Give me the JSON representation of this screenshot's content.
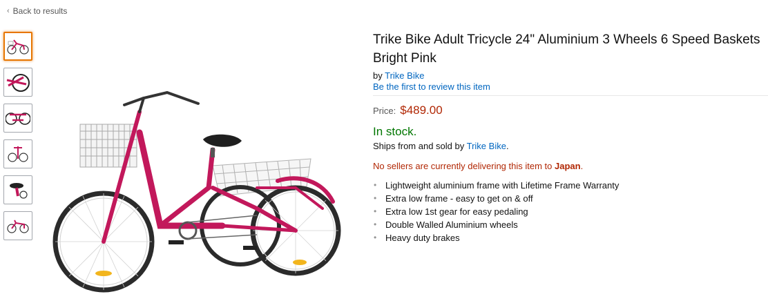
{
  "nav": {
    "back_label": "Back to results"
  },
  "thumbnails": [
    {
      "icon": "bike-front-thumbnail",
      "selected": true
    },
    {
      "icon": "bike-wheel-thumbnail",
      "selected": false
    },
    {
      "icon": "bike-rear-thumbnail",
      "selected": false
    },
    {
      "icon": "bike-frontview-thumbnail",
      "selected": false
    },
    {
      "icon": "bike-seat-thumbnail",
      "selected": false
    },
    {
      "icon": "bike-side-thumbnail",
      "selected": false
    }
  ],
  "product": {
    "title": "Trike Bike Adult Tricycle 24\" Aluminium 3 Wheels 6 Speed Baskets Bright Pink",
    "by_prefix": "by",
    "brand": "Trike Bike",
    "review_link": "Be the first to review this item",
    "price_label": "Price:",
    "price": "$489.00",
    "stock": "In stock.",
    "ships_prefix": "Ships from and sold by",
    "seller": "Trike Bike",
    "ships_suffix": ".",
    "no_delivery_text": "No sellers are currently delivering this item to",
    "no_delivery_country": "Japan",
    "no_delivery_suffix": ".",
    "features": [
      "Lightweight aluminium frame with Lifetime Frame Warranty",
      "Extra low frame - easy to get on & off",
      "Extra low 1st gear for easy pedaling",
      "Double Walled Aluminium wheels",
      "Heavy duty brakes"
    ]
  },
  "colors": {
    "frame": "#c2185b",
    "link": "#0066c0",
    "price": "#b12704",
    "stock": "#007600",
    "selected_border": "#e77600"
  }
}
